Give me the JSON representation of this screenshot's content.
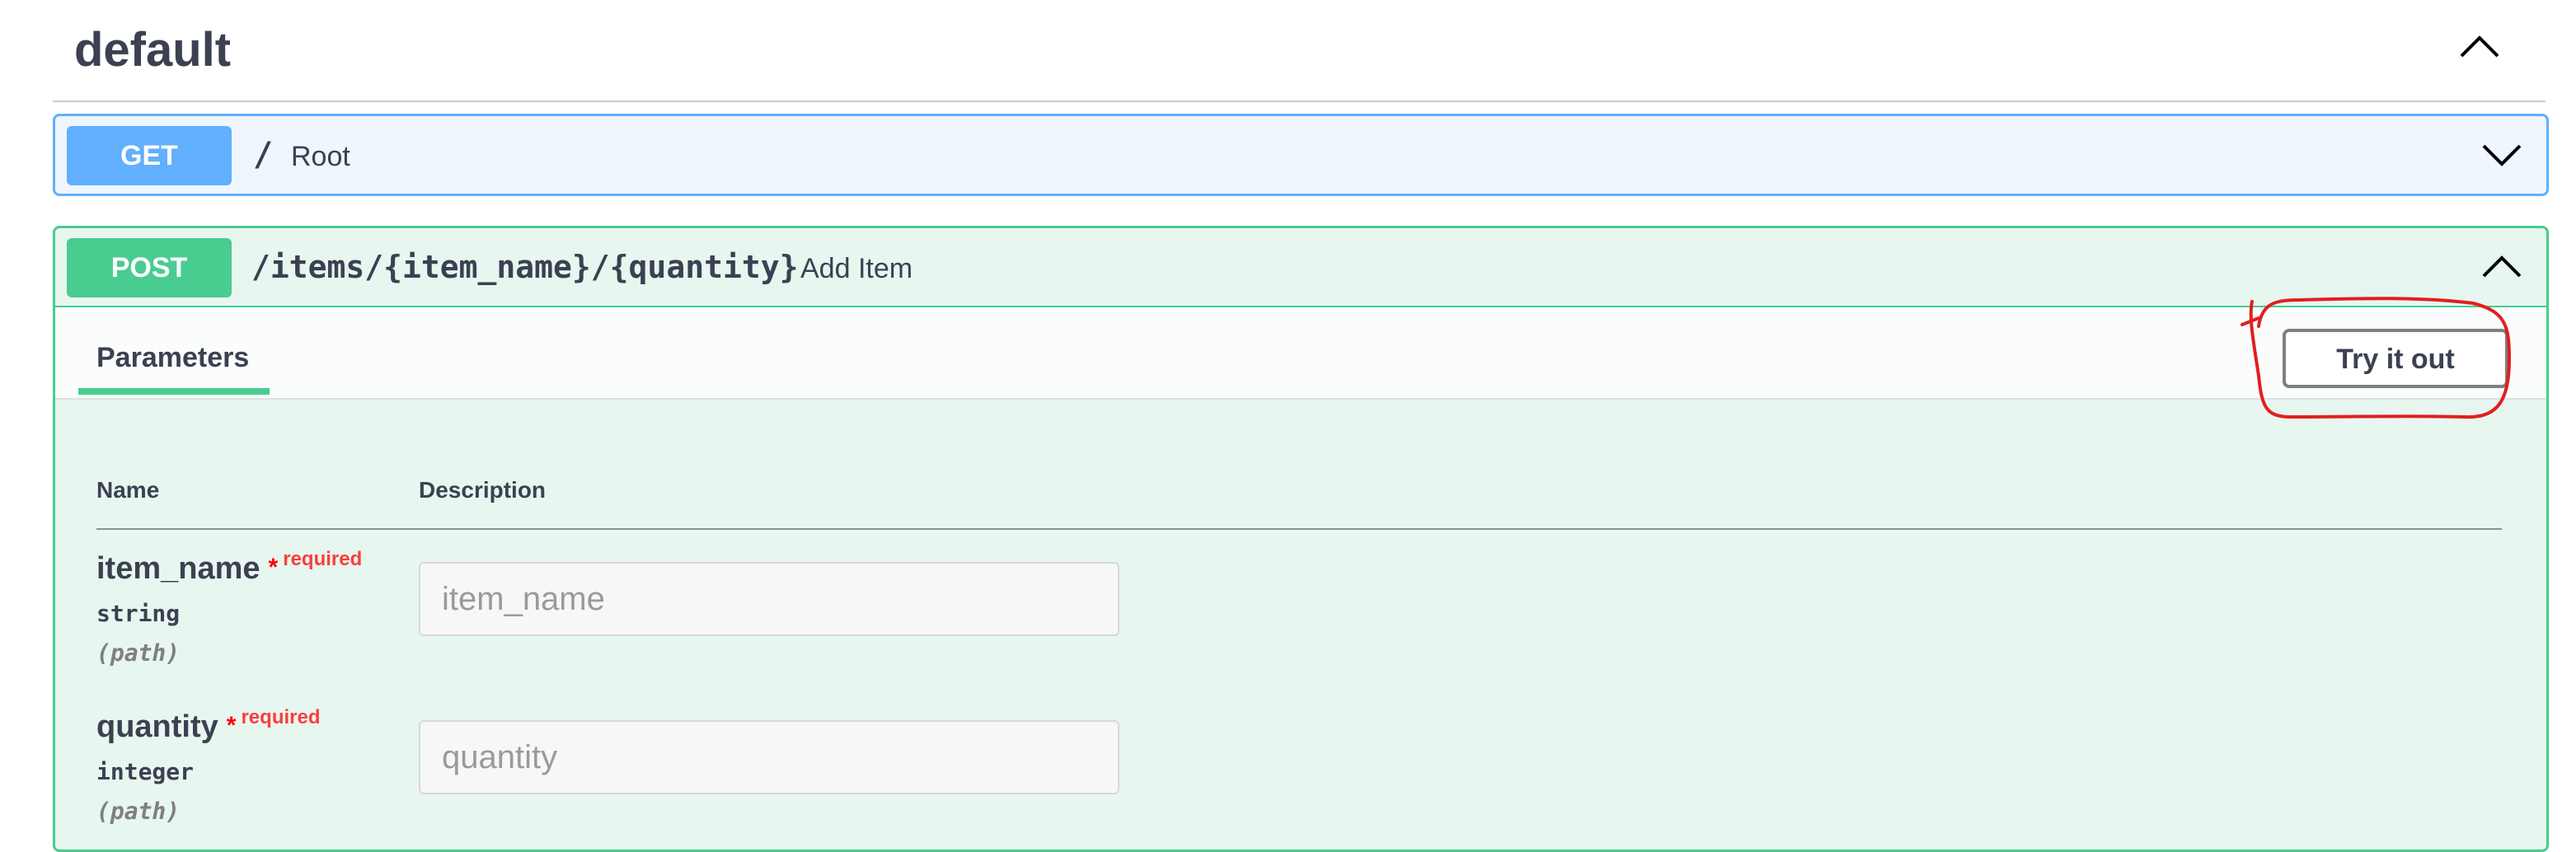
{
  "tag": {
    "title": "default",
    "toggle_icon": "chevron-up-icon"
  },
  "operations": [
    {
      "method": "GET",
      "path": "/",
      "summary": "Root",
      "expanded": false,
      "color": "#61affe",
      "toggle_icon": "chevron-down-icon"
    },
    {
      "method": "POST",
      "path": "/items/{item_name}/{quantity}",
      "summary": "Add Item",
      "expanded": true,
      "color": "#49cc90",
      "toggle_icon": "chevron-up-icon"
    }
  ],
  "parameters_section": {
    "tab_label": "Parameters",
    "try_button_label": "Try it out",
    "columns": [
      "Name",
      "Description"
    ],
    "params": [
      {
        "name": "item_name",
        "required_star": "*",
        "required_label": "required",
        "type": "string",
        "in": "(path)",
        "placeholder": "item_name",
        "value": ""
      },
      {
        "name": "quantity",
        "required_star": "*",
        "required_label": "required",
        "type": "integer",
        "in": "(path)",
        "placeholder": "quantity",
        "value": ""
      }
    ]
  },
  "annotation": {
    "color": "#e02020",
    "target": "try-it-out-button"
  }
}
